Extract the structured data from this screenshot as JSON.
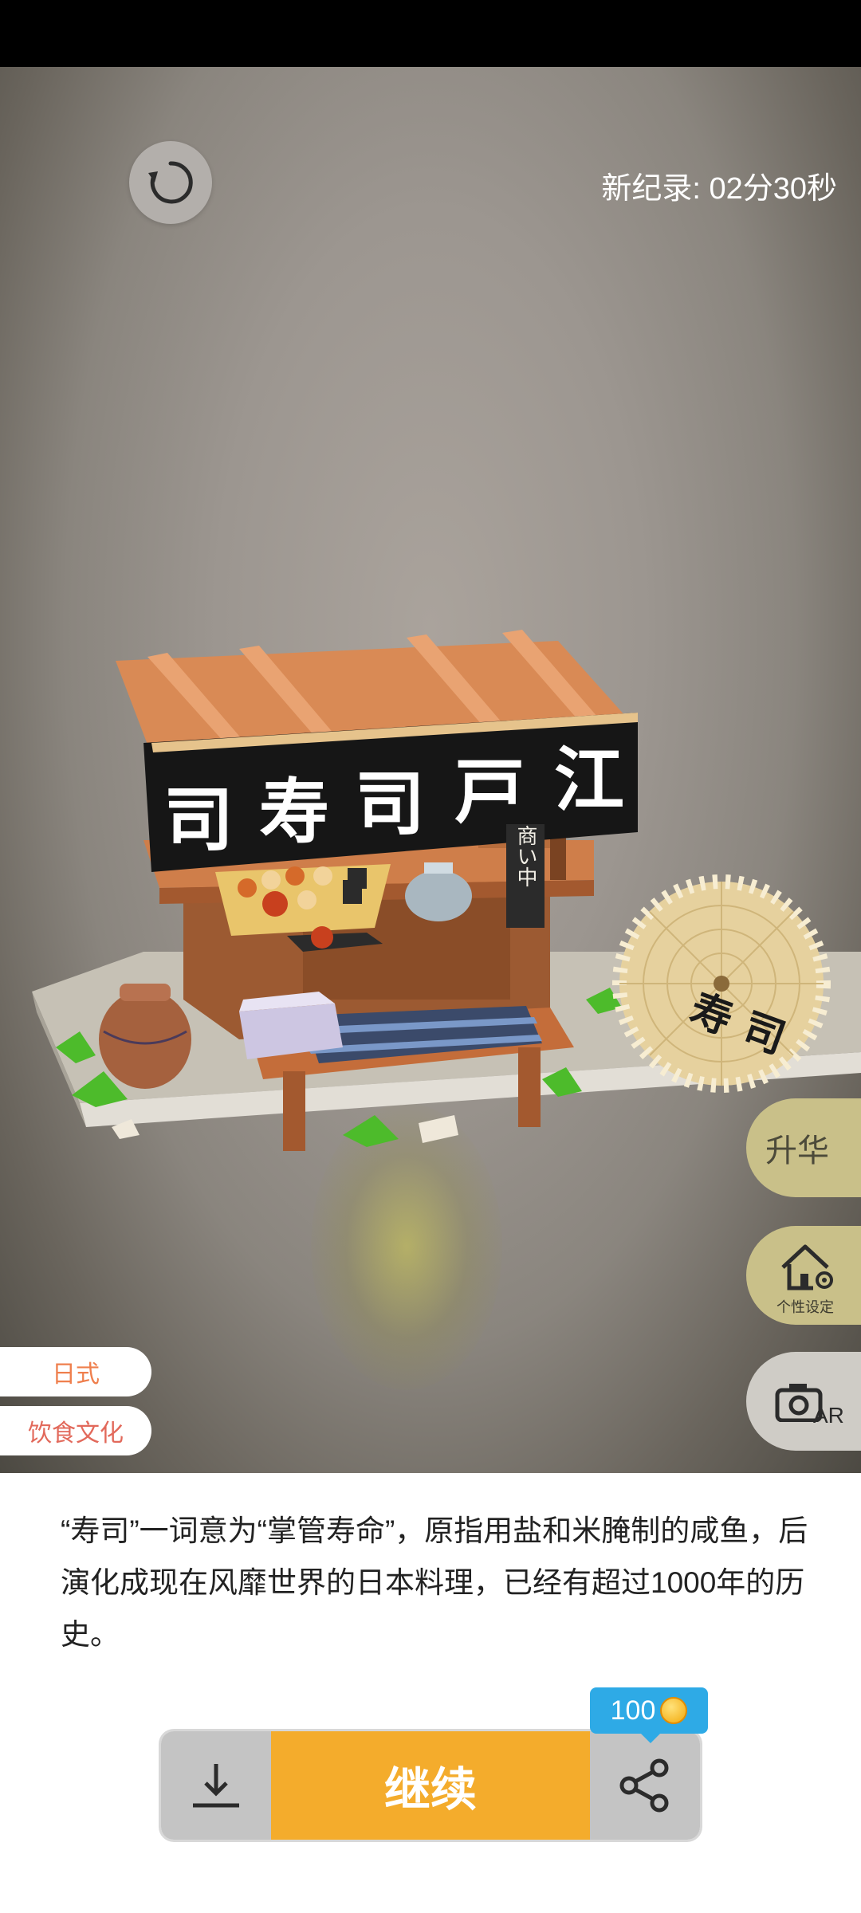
{
  "header": {
    "record_label": "新纪录: 02分30秒"
  },
  "scene": {
    "noren_sign": [
      "司",
      "寿",
      "司",
      "戸",
      "江"
    ],
    "lantern_sign": "寿 司",
    "menu_sign": "商い中"
  },
  "side_buttons": {
    "upgrade_label": "升华",
    "customize_label": "个性设定",
    "ar_label": "AR"
  },
  "tags": {
    "style": "日式",
    "category": "饮食文化"
  },
  "description": "“寿司”一词意为“掌管寿命”，原指用盐和米腌制的咸鱼，后演化成现在风靡世界的日本料理，已经有超过1000年的历史。",
  "actions": {
    "continue_label": "继续",
    "coin_reward": "100"
  },
  "colors": {
    "continue": "#f4ac2c",
    "coin_badge": "#2eaae6",
    "side_button": "#c9c089"
  }
}
